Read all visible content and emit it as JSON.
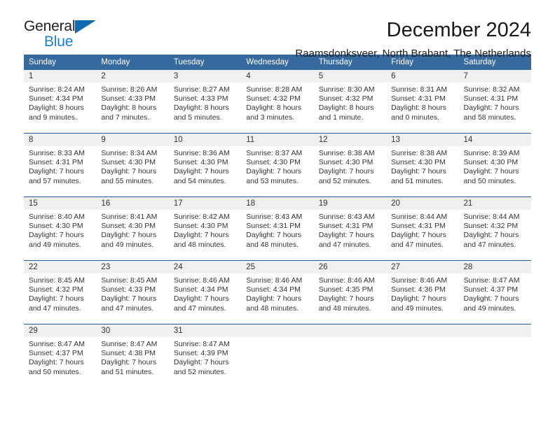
{
  "brand": {
    "name_top": "General",
    "name_bottom": "Blue",
    "triangle_color": "#0d6bb3",
    "blue_text_color": "#1a7fd4"
  },
  "header": {
    "title": "December 2024",
    "subtitle": "Raamsdonksveer, North Brabant, The Netherlands"
  },
  "colors": {
    "header_row_bg": "#36699e",
    "header_row_text": "#ffffff",
    "daynum_bg": "#f0f0f0",
    "row_separator": "#1f5c9e"
  },
  "weekday_headers": [
    "Sunday",
    "Monday",
    "Tuesday",
    "Wednesday",
    "Thursday",
    "Friday",
    "Saturday"
  ],
  "weeks": [
    [
      {
        "day": "1",
        "sunrise": "Sunrise: 8:24 AM",
        "sunset": "Sunset: 4:34 PM",
        "daylight_line1": "Daylight: 8 hours",
        "daylight_line2": "and 9 minutes."
      },
      {
        "day": "2",
        "sunrise": "Sunrise: 8:26 AM",
        "sunset": "Sunset: 4:33 PM",
        "daylight_line1": "Daylight: 8 hours",
        "daylight_line2": "and 7 minutes."
      },
      {
        "day": "3",
        "sunrise": "Sunrise: 8:27 AM",
        "sunset": "Sunset: 4:33 PM",
        "daylight_line1": "Daylight: 8 hours",
        "daylight_line2": "and 5 minutes."
      },
      {
        "day": "4",
        "sunrise": "Sunrise: 8:28 AM",
        "sunset": "Sunset: 4:32 PM",
        "daylight_line1": "Daylight: 8 hours",
        "daylight_line2": "and 3 minutes."
      },
      {
        "day": "5",
        "sunrise": "Sunrise: 8:30 AM",
        "sunset": "Sunset: 4:32 PM",
        "daylight_line1": "Daylight: 8 hours",
        "daylight_line2": "and 1 minute."
      },
      {
        "day": "6",
        "sunrise": "Sunrise: 8:31 AM",
        "sunset": "Sunset: 4:31 PM",
        "daylight_line1": "Daylight: 8 hours",
        "daylight_line2": "and 0 minutes."
      },
      {
        "day": "7",
        "sunrise": "Sunrise: 8:32 AM",
        "sunset": "Sunset: 4:31 PM",
        "daylight_line1": "Daylight: 7 hours",
        "daylight_line2": "and 58 minutes."
      }
    ],
    [
      {
        "day": "8",
        "sunrise": "Sunrise: 8:33 AM",
        "sunset": "Sunset: 4:31 PM",
        "daylight_line1": "Daylight: 7 hours",
        "daylight_line2": "and 57 minutes."
      },
      {
        "day": "9",
        "sunrise": "Sunrise: 8:34 AM",
        "sunset": "Sunset: 4:30 PM",
        "daylight_line1": "Daylight: 7 hours",
        "daylight_line2": "and 55 minutes."
      },
      {
        "day": "10",
        "sunrise": "Sunrise: 8:36 AM",
        "sunset": "Sunset: 4:30 PM",
        "daylight_line1": "Daylight: 7 hours",
        "daylight_line2": "and 54 minutes."
      },
      {
        "day": "11",
        "sunrise": "Sunrise: 8:37 AM",
        "sunset": "Sunset: 4:30 PM",
        "daylight_line1": "Daylight: 7 hours",
        "daylight_line2": "and 53 minutes."
      },
      {
        "day": "12",
        "sunrise": "Sunrise: 8:38 AM",
        "sunset": "Sunset: 4:30 PM",
        "daylight_line1": "Daylight: 7 hours",
        "daylight_line2": "and 52 minutes."
      },
      {
        "day": "13",
        "sunrise": "Sunrise: 8:38 AM",
        "sunset": "Sunset: 4:30 PM",
        "daylight_line1": "Daylight: 7 hours",
        "daylight_line2": "and 51 minutes."
      },
      {
        "day": "14",
        "sunrise": "Sunrise: 8:39 AM",
        "sunset": "Sunset: 4:30 PM",
        "daylight_line1": "Daylight: 7 hours",
        "daylight_line2": "and 50 minutes."
      }
    ],
    [
      {
        "day": "15",
        "sunrise": "Sunrise: 8:40 AM",
        "sunset": "Sunset: 4:30 PM",
        "daylight_line1": "Daylight: 7 hours",
        "daylight_line2": "and 49 minutes."
      },
      {
        "day": "16",
        "sunrise": "Sunrise: 8:41 AM",
        "sunset": "Sunset: 4:30 PM",
        "daylight_line1": "Daylight: 7 hours",
        "daylight_line2": "and 49 minutes."
      },
      {
        "day": "17",
        "sunrise": "Sunrise: 8:42 AM",
        "sunset": "Sunset: 4:30 PM",
        "daylight_line1": "Daylight: 7 hours",
        "daylight_line2": "and 48 minutes."
      },
      {
        "day": "18",
        "sunrise": "Sunrise: 8:43 AM",
        "sunset": "Sunset: 4:31 PM",
        "daylight_line1": "Daylight: 7 hours",
        "daylight_line2": "and 48 minutes."
      },
      {
        "day": "19",
        "sunrise": "Sunrise: 8:43 AM",
        "sunset": "Sunset: 4:31 PM",
        "daylight_line1": "Daylight: 7 hours",
        "daylight_line2": "and 47 minutes."
      },
      {
        "day": "20",
        "sunrise": "Sunrise: 8:44 AM",
        "sunset": "Sunset: 4:31 PM",
        "daylight_line1": "Daylight: 7 hours",
        "daylight_line2": "and 47 minutes."
      },
      {
        "day": "21",
        "sunrise": "Sunrise: 8:44 AM",
        "sunset": "Sunset: 4:32 PM",
        "daylight_line1": "Daylight: 7 hours",
        "daylight_line2": "and 47 minutes."
      }
    ],
    [
      {
        "day": "22",
        "sunrise": "Sunrise: 8:45 AM",
        "sunset": "Sunset: 4:32 PM",
        "daylight_line1": "Daylight: 7 hours",
        "daylight_line2": "and 47 minutes."
      },
      {
        "day": "23",
        "sunrise": "Sunrise: 8:45 AM",
        "sunset": "Sunset: 4:33 PM",
        "daylight_line1": "Daylight: 7 hours",
        "daylight_line2": "and 47 minutes."
      },
      {
        "day": "24",
        "sunrise": "Sunrise: 8:46 AM",
        "sunset": "Sunset: 4:34 PM",
        "daylight_line1": "Daylight: 7 hours",
        "daylight_line2": "and 47 minutes."
      },
      {
        "day": "25",
        "sunrise": "Sunrise: 8:46 AM",
        "sunset": "Sunset: 4:34 PM",
        "daylight_line1": "Daylight: 7 hours",
        "daylight_line2": "and 48 minutes."
      },
      {
        "day": "26",
        "sunrise": "Sunrise: 8:46 AM",
        "sunset": "Sunset: 4:35 PM",
        "daylight_line1": "Daylight: 7 hours",
        "daylight_line2": "and 48 minutes."
      },
      {
        "day": "27",
        "sunrise": "Sunrise: 8:46 AM",
        "sunset": "Sunset: 4:36 PM",
        "daylight_line1": "Daylight: 7 hours",
        "daylight_line2": "and 49 minutes."
      },
      {
        "day": "28",
        "sunrise": "Sunrise: 8:47 AM",
        "sunset": "Sunset: 4:37 PM",
        "daylight_line1": "Daylight: 7 hours",
        "daylight_line2": "and 49 minutes."
      }
    ],
    [
      {
        "day": "29",
        "sunrise": "Sunrise: 8:47 AM",
        "sunset": "Sunset: 4:37 PM",
        "daylight_line1": "Daylight: 7 hours",
        "daylight_line2": "and 50 minutes."
      },
      {
        "day": "30",
        "sunrise": "Sunrise: 8:47 AM",
        "sunset": "Sunset: 4:38 PM",
        "daylight_line1": "Daylight: 7 hours",
        "daylight_line2": "and 51 minutes."
      },
      {
        "day": "31",
        "sunrise": "Sunrise: 8:47 AM",
        "sunset": "Sunset: 4:39 PM",
        "daylight_line1": "Daylight: 7 hours",
        "daylight_line2": "and 52 minutes."
      },
      {
        "day": "",
        "sunrise": "",
        "sunset": "",
        "daylight_line1": "",
        "daylight_line2": ""
      },
      {
        "day": "",
        "sunrise": "",
        "sunset": "",
        "daylight_line1": "",
        "daylight_line2": ""
      },
      {
        "day": "",
        "sunrise": "",
        "sunset": "",
        "daylight_line1": "",
        "daylight_line2": ""
      },
      {
        "day": "",
        "sunrise": "",
        "sunset": "",
        "daylight_line1": "",
        "daylight_line2": ""
      }
    ]
  ]
}
